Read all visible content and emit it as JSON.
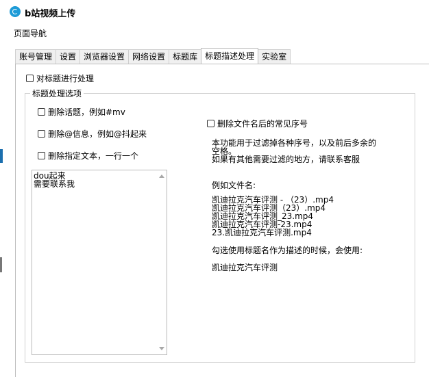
{
  "window": {
    "title": "b站视频上传"
  },
  "nav_title": "页面导航",
  "tabs": [
    {
      "label": "账号管理"
    },
    {
      "label": "设置"
    },
    {
      "label": "浏览器设置"
    },
    {
      "label": "网络设置"
    },
    {
      "label": "标题库"
    },
    {
      "label": "标题描述处理",
      "active": true
    },
    {
      "label": "实验室"
    }
  ],
  "process_title": {
    "label": "对标题进行处理",
    "checked": false
  },
  "options_group": {
    "legend": "标题处理选项",
    "remove_topic": {
      "label": "删除话题，例如#mv",
      "checked": false
    },
    "remove_at": {
      "label": "删除@信息，例如@抖起来",
      "checked": false
    },
    "remove_text": {
      "label": "删除指定文本，一行一个",
      "checked": false
    },
    "textarea_lines": [
      "dou起来",
      "需要联系我"
    ],
    "remove_serial": {
      "label": "删除文件名后的常见序号",
      "checked": false
    },
    "desc_lines": [
      "本功能用于过滤掉各种序号，以及前后多余的",
      "空格。",
      "如果有其他需要过滤的地方，请联系客服"
    ],
    "example_title": "例如文件名:",
    "example_files": [
      "凯迪拉克汽车评测 - （23）.mp4",
      "凯迪拉克汽车评测（23）.mp4",
      "凯迪拉克汽车评测_23.mp4",
      "凯迪拉克汽车评测-23.mp4",
      "23.凯迪拉克汽车评测.mp4"
    ],
    "result_note": "勾选使用标题名作为描述的时候，会使用:",
    "result_value": "凯迪拉克汽车评测"
  }
}
